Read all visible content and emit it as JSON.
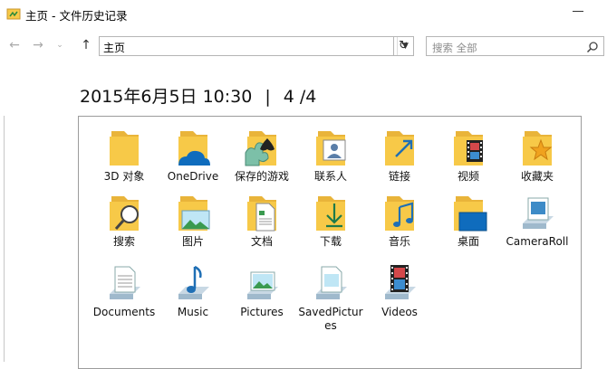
{
  "window": {
    "title": "主页 - 文件历史记录"
  },
  "nav": {
    "address": "主页",
    "search_placeholder": "搜索 全部"
  },
  "header": {
    "date": "2015年6月5日 10:30",
    "separator": "|",
    "page": "4 /4"
  },
  "items": [
    {
      "label": "3D 对象",
      "icon": "3d-objects-folder"
    },
    {
      "label": "OneDrive",
      "icon": "onedrive-folder"
    },
    {
      "label": "保存的游戏",
      "icon": "saved-games-folder"
    },
    {
      "label": "联系人",
      "icon": "contacts-folder"
    },
    {
      "label": "链接",
      "icon": "links-folder"
    },
    {
      "label": "视频",
      "icon": "videos-folder"
    },
    {
      "label": "收藏夹",
      "icon": "favorites-folder"
    },
    {
      "label": "搜索",
      "icon": "searches-folder"
    },
    {
      "label": "图片",
      "icon": "pictures-folder"
    },
    {
      "label": "文档",
      "icon": "documents-folder"
    },
    {
      "label": "下载",
      "icon": "downloads-folder"
    },
    {
      "label": "音乐",
      "icon": "music-folder"
    },
    {
      "label": "桌面",
      "icon": "desktop-folder"
    },
    {
      "label": "CameraRoll",
      "icon": "camera-roll-library"
    },
    {
      "label": "Documents",
      "icon": "documents-library"
    },
    {
      "label": "Music",
      "icon": "music-library"
    },
    {
      "label": "Pictures",
      "icon": "pictures-library"
    },
    {
      "label": "SavedPictures",
      "icon": "saved-pictures-library"
    },
    {
      "label": "Videos",
      "icon": "videos-library"
    }
  ],
  "colors": {
    "folder": "#f7c948",
    "folder_back": "#e9b43a",
    "onedrive": "#0f6cbd",
    "accent": "#2a8fd4"
  }
}
